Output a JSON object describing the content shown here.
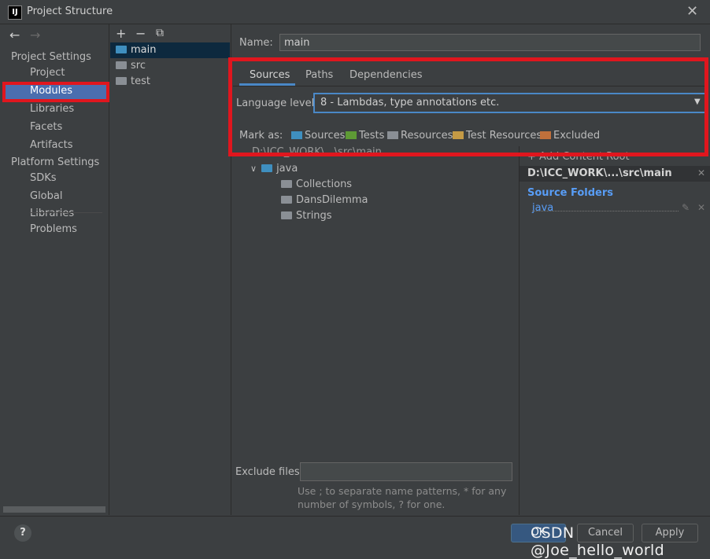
{
  "window": {
    "title": "Project Structure",
    "icon": "IJ"
  },
  "nav": {
    "project_settings_header": "Project Settings",
    "platform_settings_header": "Platform Settings",
    "items": [
      {
        "label": "Project"
      },
      {
        "label": "Modules",
        "selected": true
      },
      {
        "label": "Libraries"
      },
      {
        "label": "Facets"
      },
      {
        "label": "Artifacts"
      },
      {
        "label": "SDKs"
      },
      {
        "label": "Global Libraries"
      },
      {
        "label": "Problems"
      }
    ]
  },
  "modules": {
    "toolbar": [
      "add-icon",
      "remove-icon",
      "copy-icon"
    ],
    "items": [
      {
        "label": "main",
        "selected": true
      },
      {
        "label": "src"
      },
      {
        "label": "test"
      }
    ]
  },
  "name": {
    "label": "Name:",
    "value": "main"
  },
  "tabs": [
    {
      "label": "Sources"
    },
    {
      "label": "Paths"
    },
    {
      "label": "Dependencies"
    }
  ],
  "language": {
    "label": "Language level:",
    "value": "8 - Lambdas, type annotations etc."
  },
  "mark_as": {
    "label": "Mark as:",
    "items": [
      {
        "label": "Sources",
        "color": "#3f8fbf"
      },
      {
        "label": "Tests",
        "color": "#5e9a35"
      },
      {
        "label": "Resources",
        "color": "#8a8f95"
      },
      {
        "label": "Test Resources",
        "color": "#c49a45"
      },
      {
        "label": "Excluded",
        "color": "#c0703b"
      }
    ]
  },
  "tree": {
    "root": "D:\\ICC_WORK\\...\\src\\main",
    "java": "java",
    "packages": [
      "Collections",
      "DansDilemma",
      "Strings"
    ]
  },
  "content_root": {
    "add_label": "+ Add Content Root",
    "path": "D:\\ICC_WORK\\...\\src\\main",
    "source_folders_header": "Source Folders",
    "source_folder": "java"
  },
  "exclude": {
    "label": "Exclude files:",
    "hint": "Use ; to separate name patterns, * for any number of symbols, ? for one."
  },
  "buttons": {
    "ok": "OK",
    "cancel": "Cancel",
    "apply": "Apply",
    "help": "?"
  },
  "watermark": "CSDN @Joe_hello_world",
  "colors": {
    "accent": "#4b6eaf",
    "highlight_box": "#e0161e",
    "link": "#589df6"
  }
}
